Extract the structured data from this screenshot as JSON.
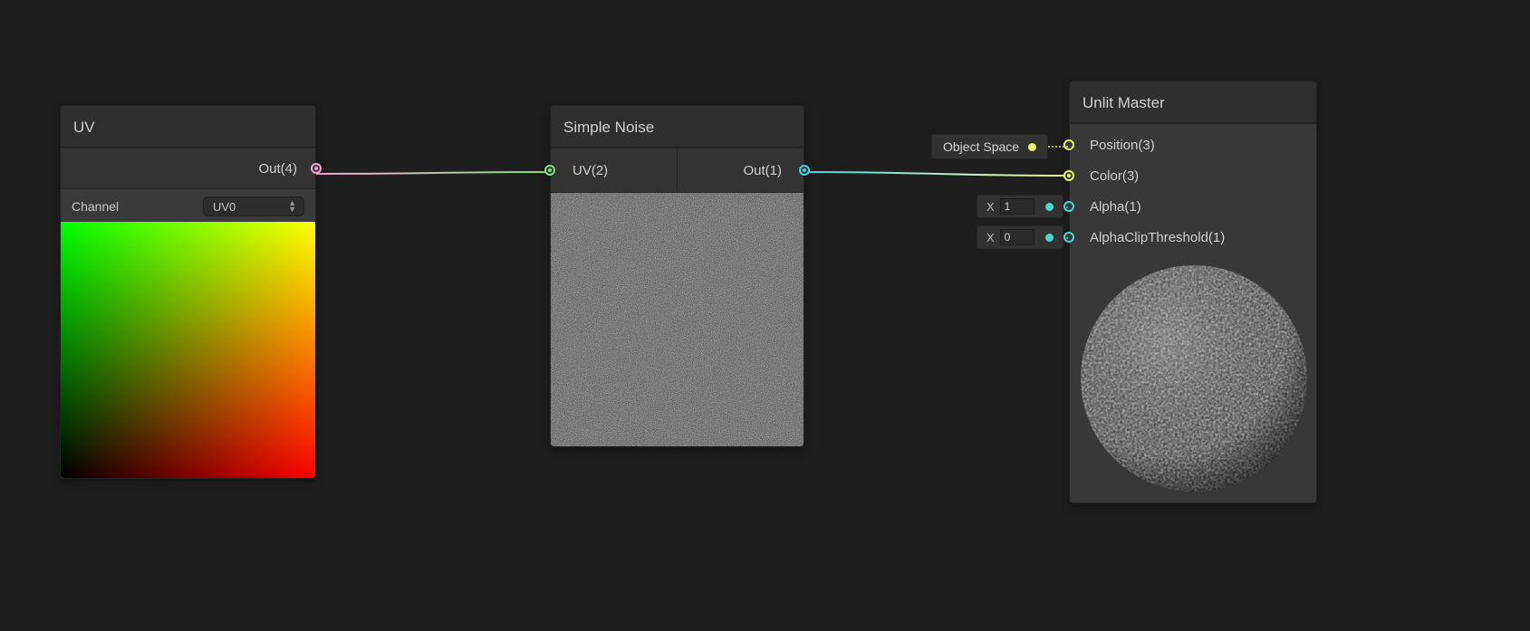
{
  "uv": {
    "title": "UV",
    "out_label": "Out(4)",
    "channel_label": "Channel",
    "channel_value": "UV0"
  },
  "noise": {
    "title": "Simple Noise",
    "in_label": "UV(2)",
    "out_label": "Out(1)"
  },
  "master": {
    "title": "Unlit Master",
    "position_space_label": "Object Space",
    "inputs": {
      "position": "Position(3)",
      "color": "Color(3)",
      "alpha": "Alpha(1)",
      "alpha_clip": "AlphaClipThreshold(1)"
    },
    "alpha_x_label": "X",
    "alpha_value": "1",
    "alphaclip_x_label": "X",
    "alphaclip_value": "0"
  }
}
